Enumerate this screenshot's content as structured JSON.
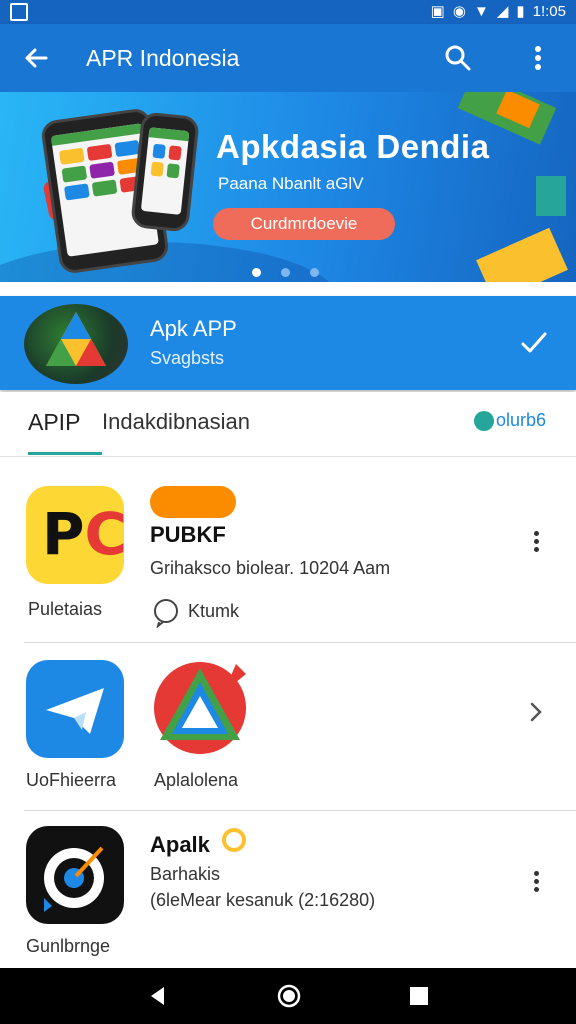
{
  "status_bar": {
    "time": "1!:05"
  },
  "app_bar": {
    "title": "APR Indonesia",
    "icons": [
      "back-arrow-icon",
      "search-icon",
      "more-vert-icon"
    ]
  },
  "banner": {
    "heading": "Apkdasia Dendia",
    "subtitle": "Paana Nbanlt aGlV",
    "button_label": "Curdmrdoevie",
    "pager": {
      "count": 3,
      "active": 0
    }
  },
  "featured": {
    "title": "Apk APP",
    "subtitle": "Svagbsts"
  },
  "tabs": {
    "tab1": "APIP",
    "tab2": "Indakdibnasian",
    "badge": "olurb6"
  },
  "apps": [
    {
      "tile_caption": "Puletaias",
      "name": "PUBKF",
      "meta": "Grihaksco biolear. 10204 Aam",
      "extra": "Ktumk"
    },
    {
      "tile_caption": "UoFhieerra",
      "second_caption": "Aplalolena"
    },
    {
      "tile_caption": "Gunlbrnge",
      "name": "Apalk",
      "meta": "Barhakis",
      "extra": "(6leMear kesanuk (2:16280)"
    }
  ],
  "colors": {
    "primary": "#1976d2",
    "accent": "#26a69a",
    "cta": "#ef6c5a"
  }
}
